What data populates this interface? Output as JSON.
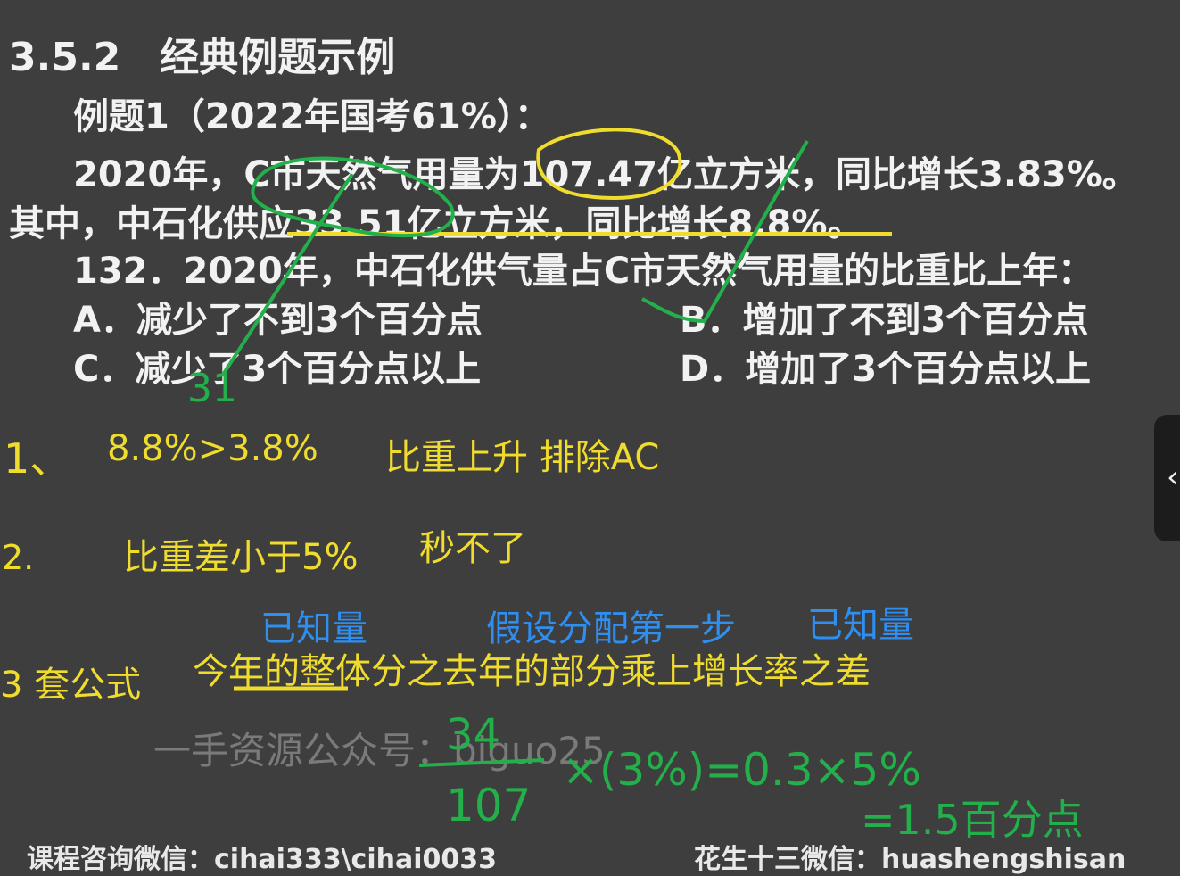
{
  "heading": "3.5.2　经典例题示例",
  "example_title": "例题1（2022年国考61%）：",
  "stem": {
    "line1": "2020年，C市天然气用量为107.47亿立方米，同比增长3.83%。",
    "line2": "其中，中石化供应33.51亿立方米，同比增长8.8%。"
  },
  "question": "132．2020年，中石化供气量占C市天然气用量的比重比上年：",
  "options": {
    "A": "A．减少了不到3个百分点",
    "B": "B．增加了不到3个百分点",
    "C": "C．减少了3个百分点以上",
    "D": "D．增加了3个百分点以上"
  },
  "notes": {
    "n1_marker": "1、",
    "n1_compare": "8.8%>3.8%",
    "n1_conclusion": "比重上升 排除AC",
    "n2_marker": "2.",
    "n2_text": "比重差小于5%",
    "n2_extra": "秒不了",
    "known1": "已知量",
    "assume": "假设分配第一步",
    "known2": "已知量",
    "n3_marker": "3 套公式",
    "n3_formula": "今年的整体分之去年的部分乘上增长率之差"
  },
  "handwriting": {
    "num_top": "34",
    "num_bottom": "107",
    "expr": "×(3%)=0.3×5%",
    "result": "=1.5百分点",
    "mark_a": "31"
  },
  "watermark": "一手资源公众号：biguo25",
  "footer": {
    "left": "课程咨询微信：cihai333\\cihai0033",
    "right": "花生十三微信：huashengshisan"
  },
  "colors": {
    "background": "#3e3e3e",
    "text_white": "#f2f2f2",
    "annotation_yellow": "#f0dc2c",
    "annotation_blue": "#2f8ff0",
    "ink_green": "#23b04a"
  }
}
